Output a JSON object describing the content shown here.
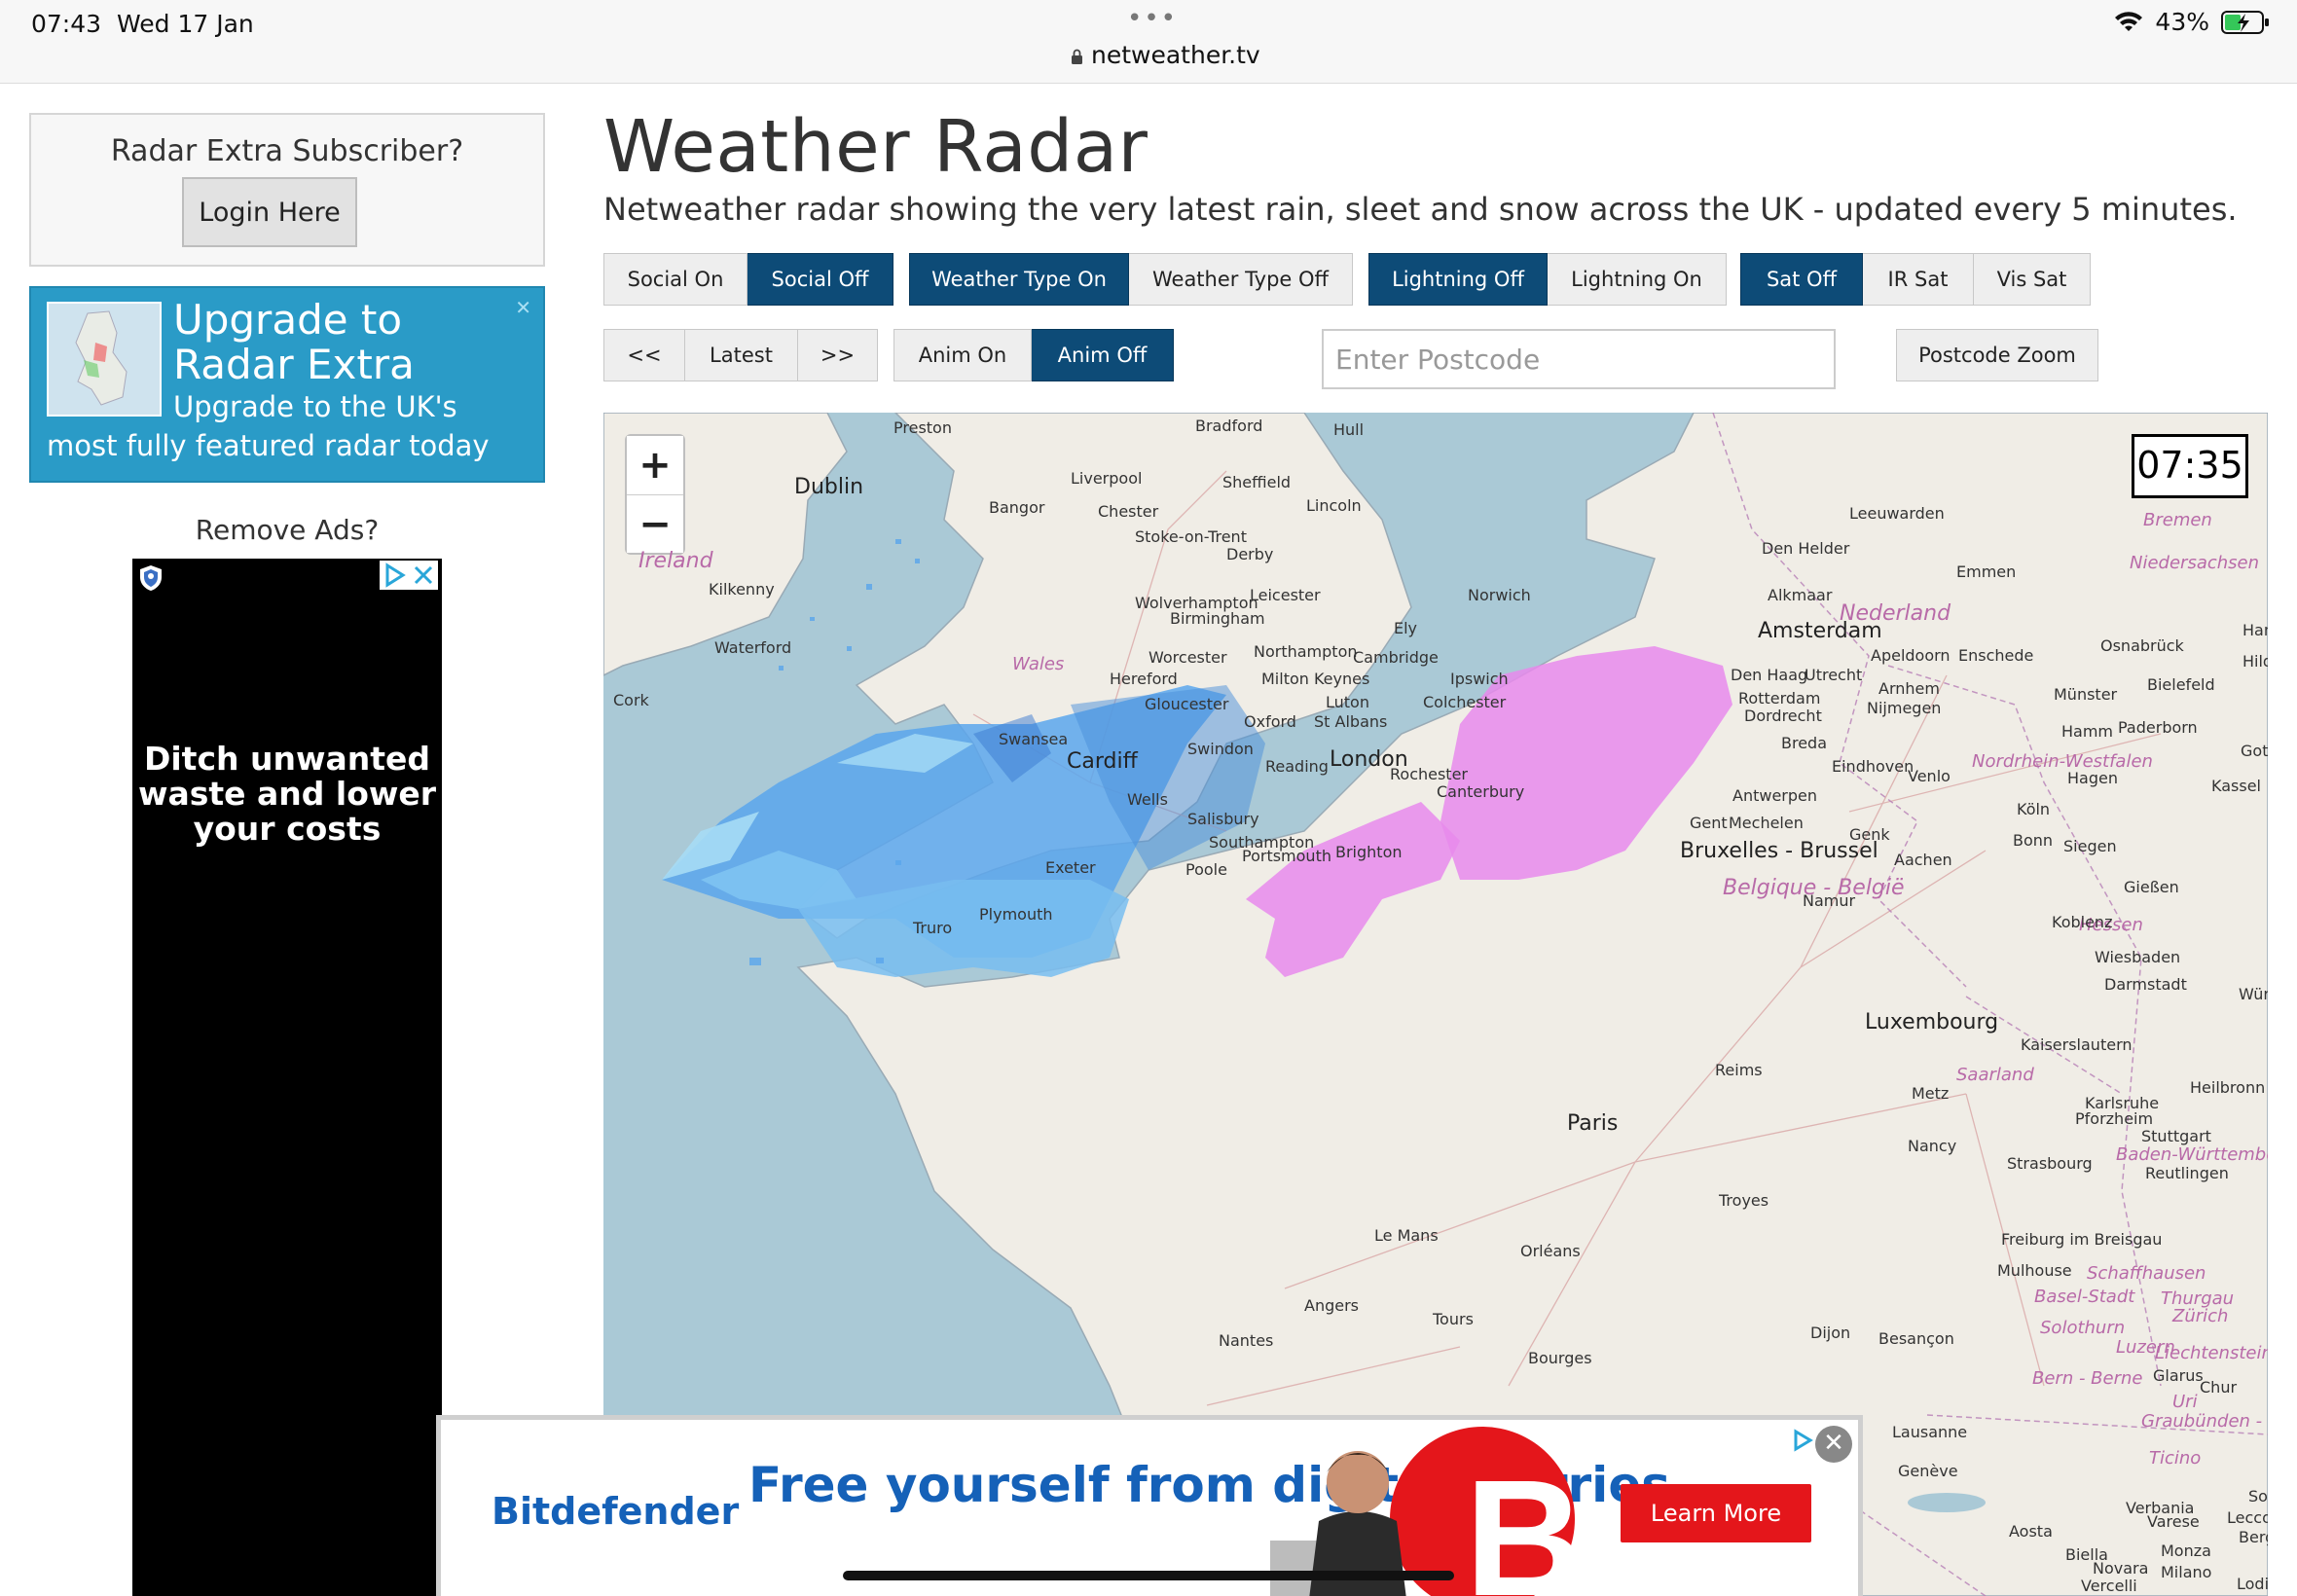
{
  "status_bar": {
    "time": "07:43",
    "date": "Wed 17 Jan",
    "dots": "•••",
    "url": "netweather.tv",
    "battery": "43%"
  },
  "sidebar": {
    "subscriber_title": "Radar Extra Subscriber?",
    "login_label": "Login Here",
    "upgrade_title": "Upgrade to Radar Extra",
    "upgrade_text": "Upgrade to the UK's most fully featured radar today",
    "remove_ads": "Remove Ads?",
    "ad_text": "Ditch unwanted waste and lower your costs"
  },
  "main": {
    "title": "Weather Radar",
    "subtitle": "Netweather radar showing the very latest rain, sleet and snow across the UK - updated every 5 minutes."
  },
  "toggles": {
    "social_on": "Social On",
    "social_off": "Social Off",
    "weather_type_on": "Weather Type On",
    "weather_type_off": "Weather Type Off",
    "lightning_off": "Lightning Off",
    "lightning_on": "Lightning On",
    "sat_off": "Sat Off",
    "ir_sat": "IR Sat",
    "vis_sat": "Vis Sat",
    "prev": "<<",
    "latest": "Latest",
    "next": ">>",
    "anim_on": "Anim On",
    "anim_off": "Anim Off"
  },
  "postcode": {
    "placeholder": "Enter Postcode",
    "zoom_label": "Postcode Zoom"
  },
  "map": {
    "time": "07:35",
    "zoom_in": "+",
    "zoom_out": "−",
    "places_big": [
      "Dublin",
      "Amsterdam",
      "London",
      "Cardiff",
      "Paris",
      "Bruxelles - Brussel",
      "Luxembourg"
    ],
    "places": [
      "Preston",
      "Bradford",
      "Hull",
      "Liverpool",
      "Sheffield",
      "Bangor",
      "Chester",
      "Lincoln",
      "Stoke-on-Trent",
      "Derby",
      "Kilkenny",
      "Leicester",
      "Norwich",
      "Wolverhampton",
      "Birmingham",
      "Ely",
      "Waterford",
      "Northampton",
      "Cambridge",
      "Worcester",
      "Hereford",
      "Milton Keynes",
      "Ipswich",
      "Cork",
      "Luton",
      "Colchester",
      "Gloucester",
      "Oxford",
      "St Albans",
      "Swansea",
      "Swindon",
      "Reading",
      "Rochester",
      "Canterbury",
      "Wells",
      "Salisbury",
      "Southampton",
      "Portsmouth",
      "Brighton",
      "Exeter",
      "Poole",
      "Truro",
      "Plymouth",
      "Leeuwarden",
      "Den Helder",
      "Alkmaar",
      "Emmen",
      "Apeldoorn",
      "Enschede",
      "Den Haag",
      "Utrecht",
      "Arnhem",
      "Rotterdam",
      "Nijmegen",
      "Dordrecht",
      "Breda",
      "Eindhoven",
      "Venlo",
      "Antwerpen",
      "Gent",
      "Mechelen",
      "Genk",
      "Aachen",
      "Namur",
      "Reims",
      "Metz",
      "Nancy",
      "Troyes",
      "Orléans",
      "Le Mans",
      "Angers",
      "Tours",
      "Nantes",
      "Bourges",
      "Dijon",
      "Besançon",
      "Strasbourg",
      "Osnabrück",
      "Münster",
      "Bielefeld",
      "Hamm",
      "Paderborn",
      "Hagen",
      "Köln",
      "Bonn",
      "Siegen",
      "Gießen",
      "Koblenz",
      "Wiesbaden",
      "Darmstadt",
      "Kaiserslautern",
      "Heilbronn",
      "Karlsruhe",
      "Pforzheim",
      "Stuttgart",
      "Reutlingen",
      "Freiburg im Breisgau",
      "Mulhouse",
      "Lausanne",
      "Genève",
      "Aosta",
      "Verbania",
      "Varese",
      "Biella",
      "Novara",
      "Milano",
      "Vercelli",
      "Lecco",
      "Bergamo",
      "Monza",
      "Lodi",
      "Chur",
      "Glarus",
      "Kassel",
      "Hannover",
      "Hildes",
      "Gotting",
      "Bremen",
      "Würzb",
      "Sondi"
    ],
    "regions": [
      "Ireland",
      "Wales",
      "Nederland",
      "Niedersachsen",
      "Nordrhein-Westfalen",
      "Belgique - België",
      "Hessen",
      "Saarland",
      "Baden-Württemberg",
      "Schaffhausen",
      "Thurgau",
      "Zürich",
      "Basel-Stadt",
      "Solothurn",
      "Luzern",
      "Bern - Berne",
      "Graubünden - Grigioni",
      "Ticino",
      "Liechtenstein",
      "Uri"
    ]
  },
  "ad_bottom": {
    "brand": "Bitdefender",
    "headline": "Free yourself from digital worries.",
    "cta": "Learn More"
  },
  "colors": {
    "accent": "#0d4b77",
    "upgrade_bg": "#2a9bc7",
    "rain": "#5aa6ec",
    "snow": "#e889ec",
    "sea": "#aac9d6",
    "land": "#f0ede6",
    "cta": "#e4161b"
  }
}
